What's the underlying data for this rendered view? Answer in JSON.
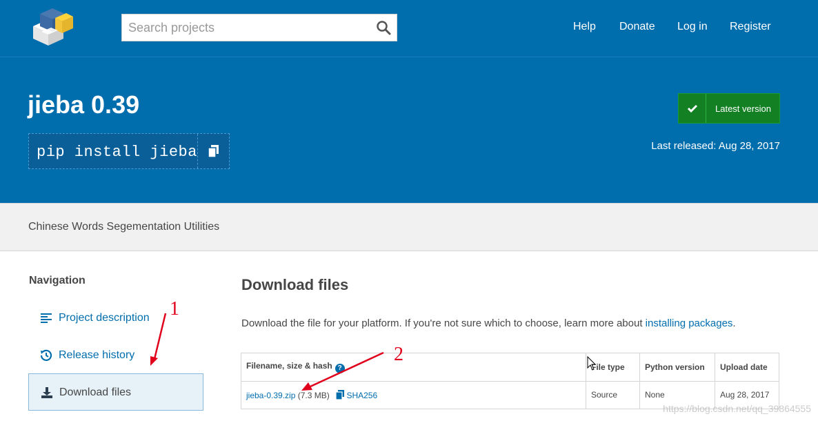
{
  "header": {
    "search_placeholder": "Search projects",
    "nav": [
      "Help",
      "Donate",
      "Log in",
      "Register"
    ]
  },
  "hero": {
    "title": "jieba 0.39",
    "pip_command": "pip install jieba",
    "latest_label": "Latest version",
    "released": "Last released: Aug 28, 2017"
  },
  "summary": "Chinese Words Segementation Utilities",
  "sidebar": {
    "title": "Navigation",
    "items": [
      {
        "label": "Project description",
        "icon": "align-left-icon"
      },
      {
        "label": "Release history",
        "icon": "history-icon"
      },
      {
        "label": "Download files",
        "icon": "download-icon"
      }
    ]
  },
  "main": {
    "title": "Download files",
    "desc_prefix": "Download the file for your platform. If you're not sure which to choose, learn more about ",
    "desc_link": "installing packages",
    "desc_suffix": ".",
    "table": {
      "headers": [
        "Filename, size & hash",
        "File type",
        "Python version",
        "Upload date"
      ],
      "row": {
        "filename": "jieba-0.39.zip",
        "size": "(7.3 MB)",
        "hash": "SHA256",
        "file_type": "Source",
        "python_version": "None",
        "upload_date": "Aug 28, 2017"
      }
    }
  },
  "annotations": [
    "1",
    "2"
  ],
  "watermark": "https://blog.csdn.net/qq_39864555",
  "colors": {
    "brand_blue": "#006dad",
    "latest_green": "#148024",
    "annotation_red": "#e0001b"
  }
}
